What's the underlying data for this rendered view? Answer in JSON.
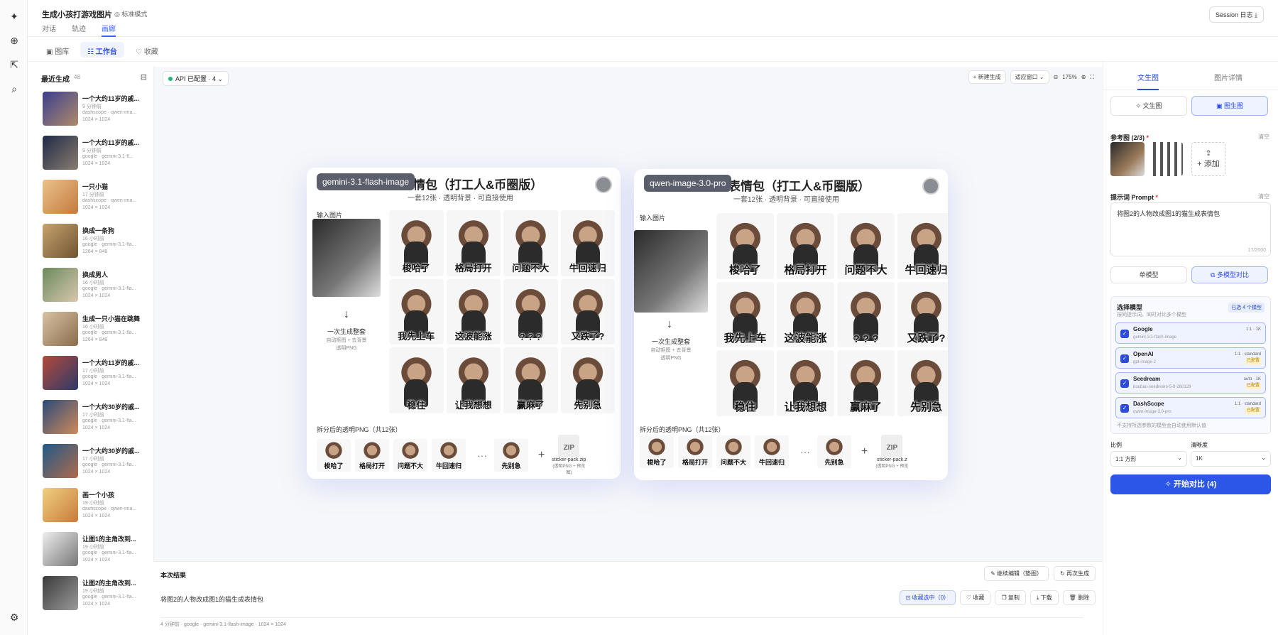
{
  "header": {
    "title": "生成小孩打游戏图片",
    "mode": "标准模式",
    "session_button": "Session 日志 ⤓"
  },
  "subtabs": [
    "对话",
    "轨迹",
    "画廊"
  ],
  "view_tabs": [
    "图库",
    "工作台",
    "收藏"
  ],
  "sidebar": {
    "title": "最近生成",
    "count": "48",
    "items": [
      {
        "name": "一个大约11岁的戚...",
        "time": "9 分钟前",
        "src": "dashscope · qwen-ima...",
        "size": "1024 × 1024",
        "c1": "#3a3f8f",
        "c2": "#b08a6a"
      },
      {
        "name": "一个大约11岁的戚...",
        "time": "9 分钟前",
        "src": "google · gemini-3.1-fl...",
        "size": "1024 × 1024",
        "c1": "#1f2a48",
        "c2": "#8a7d6f"
      },
      {
        "name": "一只小猫",
        "time": "17 分钟前",
        "src": "dashscope · qwen-ima...",
        "size": "1024 × 1024",
        "c1": "#e9c28a",
        "c2": "#c47a3d"
      },
      {
        "name": "换成一条狗",
        "time": "16 小时前",
        "src": "google · gemini-3.1-fla...",
        "size": "1264 × 848",
        "c1": "#c7a26b",
        "c2": "#6f5433"
      },
      {
        "name": "换成男人",
        "time": "16 小时前",
        "src": "google · gemini-3.1-fla...",
        "size": "1024 × 1024",
        "c1": "#6a8a5a",
        "c2": "#d9c7b0"
      },
      {
        "name": "生成一只小猫在跳舞",
        "time": "16 小时前",
        "src": "google · gemini-3.1-fla...",
        "size": "1264 × 848",
        "c1": "#d7c2a5",
        "c2": "#8a6d4b"
      },
      {
        "name": "一个大约11岁的戚...",
        "time": "17 小时前",
        "src": "google · gemini-3.1-fla...",
        "size": "1024 × 1024",
        "c1": "#b44a3a",
        "c2": "#2c3a6a"
      },
      {
        "name": "一个大约30岁的戚...",
        "time": "17 小时前",
        "src": "google · gemini-3.1-fla...",
        "size": "1024 × 1024",
        "c1": "#2a4a7a",
        "c2": "#d08a5a"
      },
      {
        "name": "一个大约30岁的戚...",
        "time": "17 小时前",
        "src": "google · gemini-3.1-fla...",
        "size": "1024 × 1024",
        "c1": "#1f5a8a",
        "c2": "#b06a4a"
      },
      {
        "name": "画一个小孩",
        "time": "19 小时前",
        "src": "dashscope · qwen-ima...",
        "size": "1024 × 1024",
        "c1": "#f0d080",
        "c2": "#c87a3a"
      },
      {
        "name": "让图1的主角改到...",
        "time": "19 小时前",
        "src": "google · gemini-3.1-fla...",
        "size": "1024 × 1024",
        "c1": "#eeeeee",
        "c2": "#777777"
      },
      {
        "name": "让图2的主角改到...",
        "time": "19 小时前",
        "src": "google · gemini-3.1-fla...",
        "size": "1024 × 1024",
        "c1": "#3a3a3a",
        "c2": "#9a9a9a"
      }
    ]
  },
  "canvas": {
    "api_badge": "API 已配置 · 4",
    "new_button": "+ 新建生成",
    "fit_button": "适应窗口",
    "zoom": "175%",
    "cards": [
      {
        "model": "gemini-3.1-flash-image",
        "title": "情包（打工人&币圈版）",
        "subtitle": "一套12张 · 透明背景 · 可直接使用",
        "input_label": "输入图片",
        "once": "一次生成整套",
        "once_sub1": "自动抠图 + 去背景",
        "once_sub2": "透明PNG",
        "split_label": "拆分后的透明PNG（共12张）",
        "zip_name": "sticker-pack.zip",
        "zip_sub": "(透明PNG + 预览图)"
      },
      {
        "model": "qwen-image-3.0-pro",
        "title": "漫画猫表情包（打工人&币圈版）",
        "subtitle": "一套12张 · 透明背景 · 可直接使用",
        "input_label": "输入图片",
        "once": "一次生成整套",
        "once_sub1": "自动抠图 + 去背景",
        "once_sub2": "透明PNG",
        "split_label": "拆分后的透明PNG（共12张）",
        "zip_name": "sticker-pack.z",
        "zip_sub": "(透明PNG + 预览"
      }
    ],
    "captions": [
      "梭哈了",
      "格局打开",
      "问题不大",
      "牛回速归",
      "我先上车",
      "这波能涨",
      "? ? ?",
      "又跌了?",
      "稳住",
      "让我想想",
      "赢麻了",
      "先别急"
    ],
    "strip_captions": [
      "梭哈了",
      "格局打开",
      "问题不大",
      "牛回速归",
      "先别急"
    ],
    "ellipsis": "···",
    "plus": "+",
    "zip": "ZIP",
    "arrow": "↓"
  },
  "result": {
    "title": "本次结果",
    "continue_edit": "继续编辑（垫图）",
    "regenerate": "再次生成",
    "prompt": "将图2的人物改成图1的猫生成表情包",
    "actions": [
      "收藏选中（0）",
      "收藏",
      "复制",
      "下载",
      "删除"
    ],
    "meta": "4 分钟前  ·  google  ·  gemini-3.1-flash-image  ·  1024 × 1024"
  },
  "right_panel": {
    "tabs": [
      "文生图",
      "图片详情"
    ],
    "modes": [
      "文生图",
      "图生图"
    ],
    "ref_label": "参考图 (2/3)",
    "ref_clear": "清空",
    "add": "添加",
    "prompt_label": "提示词 Prompt",
    "prompt_clear": "清空",
    "prompt_text": "将图2的人物改成图1的猫生成表情包",
    "prompt_count": "17/2000",
    "model_modes": [
      "单模型",
      "多模型对比"
    ],
    "model_select_title": "选择模型",
    "model_select_sub": "按同提示词，同时对比多个模型",
    "selected_badge": "已选 4 个模型",
    "models": [
      {
        "provider": "Google",
        "id": "gemini-3.1-flash-image",
        "right": "1:1 · 1K",
        "tag": ""
      },
      {
        "provider": "OpenAI",
        "id": "gpt-image-2",
        "right": "1:1 · standard",
        "tag": "已配置"
      },
      {
        "provider": "Seedream",
        "id": "doubao-seedream-5-0-260128",
        "right": "auto · 1K",
        "tag": "已配置"
      },
      {
        "provider": "DashScope",
        "id": "qwen-image-3.0-pro",
        "right": "1:1 · standard",
        "tag": "已配置"
      }
    ],
    "model_footer": "不支持所选参数的模型会自动使用默认值",
    "ratio_label": "比例",
    "ratio_value": "1:1 方形",
    "res_label": "清晰度",
    "res_value": "1K",
    "start": "开始对比 (4)"
  }
}
